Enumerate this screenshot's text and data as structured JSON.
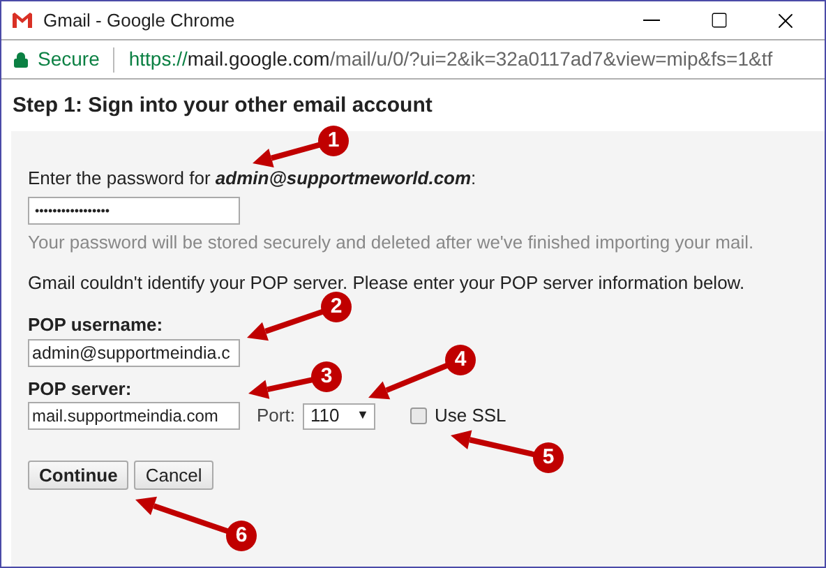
{
  "window": {
    "title": "Gmail - Google Chrome"
  },
  "address_bar": {
    "security": "Secure",
    "url_scheme": "https://",
    "url_host": "mail.google.com",
    "url_path": "/mail/u/0/?ui=2&ik=32a0117ad7&view=mip&fs=1&tf"
  },
  "heading": "Step 1: Sign into your other email account",
  "password_prompt": "Enter the password for **admin@supportmeworld.com**:",
  "password": {
    "value": "•••••••••••••••••"
  },
  "password_note": "Your password will be stored securely and deleted after we've finished importing your mail.",
  "pop_note": "Gmail couldn't identify your POP server. Please enter your POP server information below.",
  "pop_username": {
    "label": "POP username:",
    "value": "admin@supportmeindia.c"
  },
  "pop_server": {
    "label": "POP server:",
    "value": "mail.supportmeindia.com"
  },
  "port": {
    "label": "Port:",
    "value": "110",
    "caret": "▼"
  },
  "use_ssl": {
    "label": "Use SSL",
    "checked": false
  },
  "buttons": [
    {
      "label": "Continue",
      "primary": true
    },
    {
      "label": "Cancel",
      "primary": false
    }
  ],
  "annotations": [
    {
      "number": "1"
    },
    {
      "number": "2"
    },
    {
      "number": "3"
    },
    {
      "number": "4"
    },
    {
      "number": "5"
    },
    {
      "number": "6"
    }
  ]
}
